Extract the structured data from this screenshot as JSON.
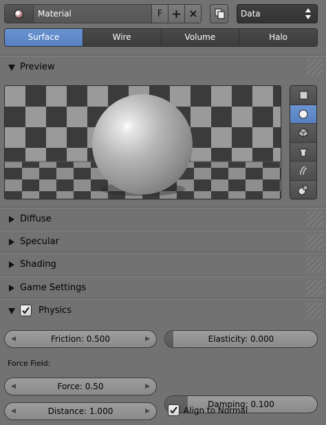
{
  "header": {
    "material_name": "Material",
    "fake_user_label": "F",
    "data_select_value": "Data"
  },
  "tabs": [
    {
      "label": "Surface",
      "active": true
    },
    {
      "label": "Wire",
      "active": false
    },
    {
      "label": "Volume",
      "active": false
    },
    {
      "label": "Halo",
      "active": false
    }
  ],
  "panels": {
    "preview": {
      "title": "Preview",
      "expanded": true
    },
    "diffuse": {
      "title": "Diffuse",
      "expanded": false
    },
    "specular": {
      "title": "Specular",
      "expanded": false
    },
    "shading": {
      "title": "Shading",
      "expanded": false
    },
    "game_settings": {
      "title": "Game Settings",
      "expanded": false
    },
    "physics": {
      "title": "Physics",
      "expanded": true,
      "enabled": true
    }
  },
  "preview_tools": [
    {
      "icon": "plane-icon",
      "active": false
    },
    {
      "icon": "sphere-icon",
      "active": true
    },
    {
      "icon": "cube-icon",
      "active": false
    },
    {
      "icon": "monkey-icon",
      "active": false
    },
    {
      "icon": "hair-icon",
      "active": false
    },
    {
      "icon": "sphere-and-cube-icon",
      "active": false
    }
  ],
  "physics": {
    "friction": {
      "label": "Friction: 0.500",
      "value": 0.5
    },
    "elasticity": {
      "label": "Elasticity: 0.000",
      "value": 0.0
    },
    "force_field_label": "Force Field:",
    "force": {
      "label": "Force: 0.50",
      "value": 0.5
    },
    "damping": {
      "label": "Damping: 0.100",
      "value": 0.1
    },
    "distance": {
      "label": "Distance: 1.000",
      "value": 1.0
    },
    "align_to_normal": {
      "label": "Align to Normal",
      "checked": true
    }
  },
  "colors": {
    "background": "#727272",
    "accent": "#5680c2",
    "field_dark": "#3c3c3c"
  }
}
